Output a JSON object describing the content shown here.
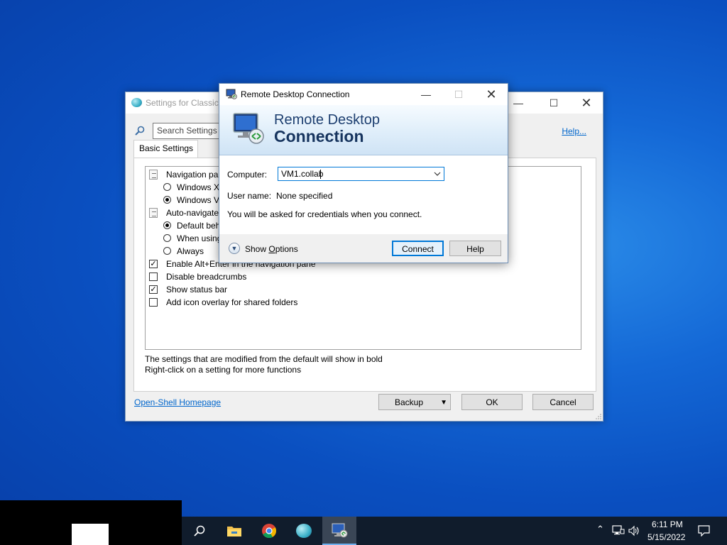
{
  "settings_window": {
    "title": "Settings for Classic",
    "search_placeholder": "Search Settings",
    "help_link": "Help...",
    "tab_basic": "Basic Settings",
    "rows": [
      {
        "kind": "group",
        "label": "Navigation par"
      },
      {
        "kind": "radio",
        "label": "Windows X",
        "checked": false
      },
      {
        "kind": "radio",
        "label": "Windows V",
        "checked": true
      },
      {
        "kind": "group",
        "label": "Auto-navigate"
      },
      {
        "kind": "radio",
        "label": "Default beh",
        "checked": true
      },
      {
        "kind": "radio",
        "label": "When using",
        "checked": false
      },
      {
        "kind": "radio",
        "label": "Always",
        "checked": false
      },
      {
        "kind": "check",
        "label": "Enable Alt+Enter in the navigation pane",
        "checked": true
      },
      {
        "kind": "check",
        "label": "Disable breadcrumbs",
        "checked": false
      },
      {
        "kind": "check",
        "label": "Show status bar",
        "checked": true
      },
      {
        "kind": "check",
        "label": "Add icon overlay for shared folders",
        "checked": false
      }
    ],
    "footnote_1": "The settings that are modified from the default will show in bold",
    "footnote_2": "Right-click on a setting for more functions",
    "homepage_link": "Open-Shell Homepage",
    "backup_label": "Backup",
    "ok_label": "OK",
    "cancel_label": "Cancel"
  },
  "rdp_window": {
    "title": "Remote Desktop Connection",
    "banner_line1": "Remote Desktop",
    "banner_line2": "Connection",
    "computer_label": "Computer:",
    "computer_value": "VM1.collab",
    "username_label": "User name:",
    "username_value": "None specified",
    "credentials_note": "You will be asked for credentials when you connect.",
    "show_options_prefix": "Show ",
    "show_options_underlined": "O",
    "show_options_suffix": "ptions",
    "connect_label": "Connect",
    "help_label": "Help"
  },
  "taskbar": {
    "pinned": [
      "search-icon",
      "file-explorer-icon",
      "chrome-icon",
      "open-shell-settings-icon",
      "remote-desktop-icon"
    ],
    "clock_time": "6:11 PM",
    "clock_date": "5/15/2022"
  },
  "colors": {
    "accent": "#0078d7",
    "link": "#0066cc",
    "taskbar": "#101c2c"
  }
}
